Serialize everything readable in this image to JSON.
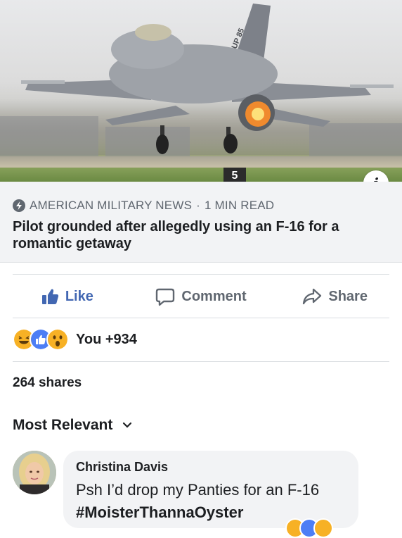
{
  "post": {
    "image": {
      "subject": "jet-photo",
      "tail_text": "UP 85",
      "runway_marker": "5"
    },
    "info_icon": "info-icon",
    "link": {
      "source": "AMERICAN MILITARY NEWS",
      "separator": "·",
      "read_time": "1 MIN READ",
      "headline": "Pilot grounded after allegedly using an F-16 for a romantic getaway"
    }
  },
  "actions": {
    "like": "Like",
    "comment": "Comment",
    "share": "Share"
  },
  "reactions": {
    "icons": [
      "haha-reaction-icon",
      "like-reaction-icon",
      "wow-reaction-icon"
    ],
    "summary": "You +934"
  },
  "shares": "264 shares",
  "comments": {
    "sort_label": "Most Relevant",
    "items": [
      {
        "author": "Christina Davis",
        "text": "Psh I’d drop my Panties for an F-16",
        "hashtag": "#MoisterThannaOyster"
      }
    ]
  },
  "colors": {
    "like_blue": "#4267b2",
    "muted_text": "#606770",
    "link_box_bg": "#f2f3f5",
    "haha_yellow": "#f7b125",
    "like_badge_blue": "#4d7ef5"
  }
}
